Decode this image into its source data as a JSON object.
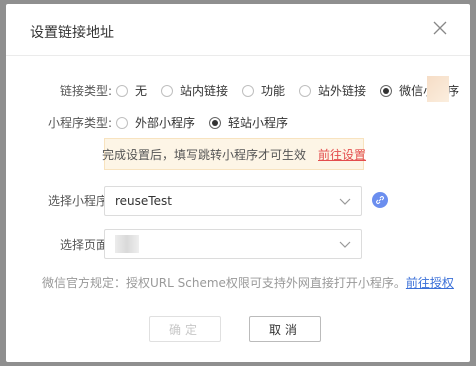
{
  "dialog": {
    "title": "设置链接地址"
  },
  "link_type": {
    "label": "链接类型:",
    "options": [
      {
        "label": "无",
        "checked": false
      },
      {
        "label": "站内链接",
        "checked": false
      },
      {
        "label": "功能",
        "checked": false
      },
      {
        "label": "站外链接",
        "checked": false
      },
      {
        "label": "微信小程序",
        "checked": true
      }
    ]
  },
  "mini_type": {
    "label": "小程序类型:",
    "options": [
      {
        "label": "外部小程序",
        "checked": false
      },
      {
        "label": "轻站小程序",
        "checked": true
      }
    ]
  },
  "notice": {
    "text": "完成设置后，填写跳转小程序才可生效",
    "link": "前往设置"
  },
  "select_mini": {
    "label": "选择小程序:",
    "value": "reuseTest"
  },
  "select_page": {
    "label": "选择页面:",
    "value": ""
  },
  "tip": {
    "text": "微信官方规定：授权URL Scheme权限可支持外网直接打开小程序。",
    "link": "前往授权"
  },
  "buttons": {
    "confirm": "确定",
    "cancel": "取消"
  },
  "colors": {
    "overlay": "#8f8f8f",
    "link_blue": "#3a6fd8",
    "notice_link_red": "#e34d4d",
    "notice_bg": "#fdf5e6",
    "link_icon": "#6b8eef"
  }
}
